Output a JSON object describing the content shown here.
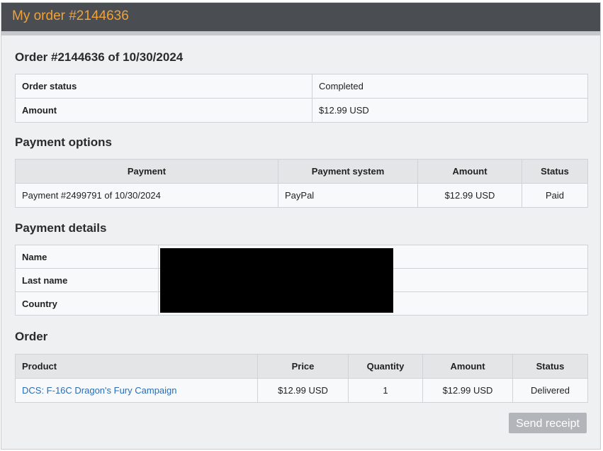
{
  "page_title": "My order #2144636",
  "order_heading": "Order #2144636 of 10/30/2024",
  "summary": [
    {
      "label": "Order status",
      "value": "Completed"
    },
    {
      "label": "Amount",
      "value": "$12.99 USD"
    }
  ],
  "payment_options": {
    "heading": "Payment options",
    "columns": [
      "Payment",
      "Payment system",
      "Amount",
      "Status"
    ],
    "rows": [
      [
        "Payment #2499791 of 10/30/2024",
        "PayPal",
        "$12.99 USD",
        "Paid"
      ]
    ]
  },
  "payment_details": {
    "heading": "Payment details",
    "rows": [
      {
        "label": "Name",
        "value": ""
      },
      {
        "label": "Last name",
        "value": ""
      },
      {
        "label": "Country",
        "value": ""
      }
    ]
  },
  "order": {
    "heading": "Order",
    "columns": [
      "Product",
      "Price",
      "Quantity",
      "Amount",
      "Status"
    ],
    "rows": [
      [
        "DCS: F-16C Dragon's Fury Campaign",
        "$12.99 USD",
        "1",
        "$12.99 USD",
        "Delivered"
      ]
    ]
  },
  "send_receipt_label": "Send receipt",
  "colors": {
    "title_bar": "#4a4d52",
    "title_text": "#f0a23a",
    "link": "#2a6db5",
    "button": "#b2b6bb"
  }
}
